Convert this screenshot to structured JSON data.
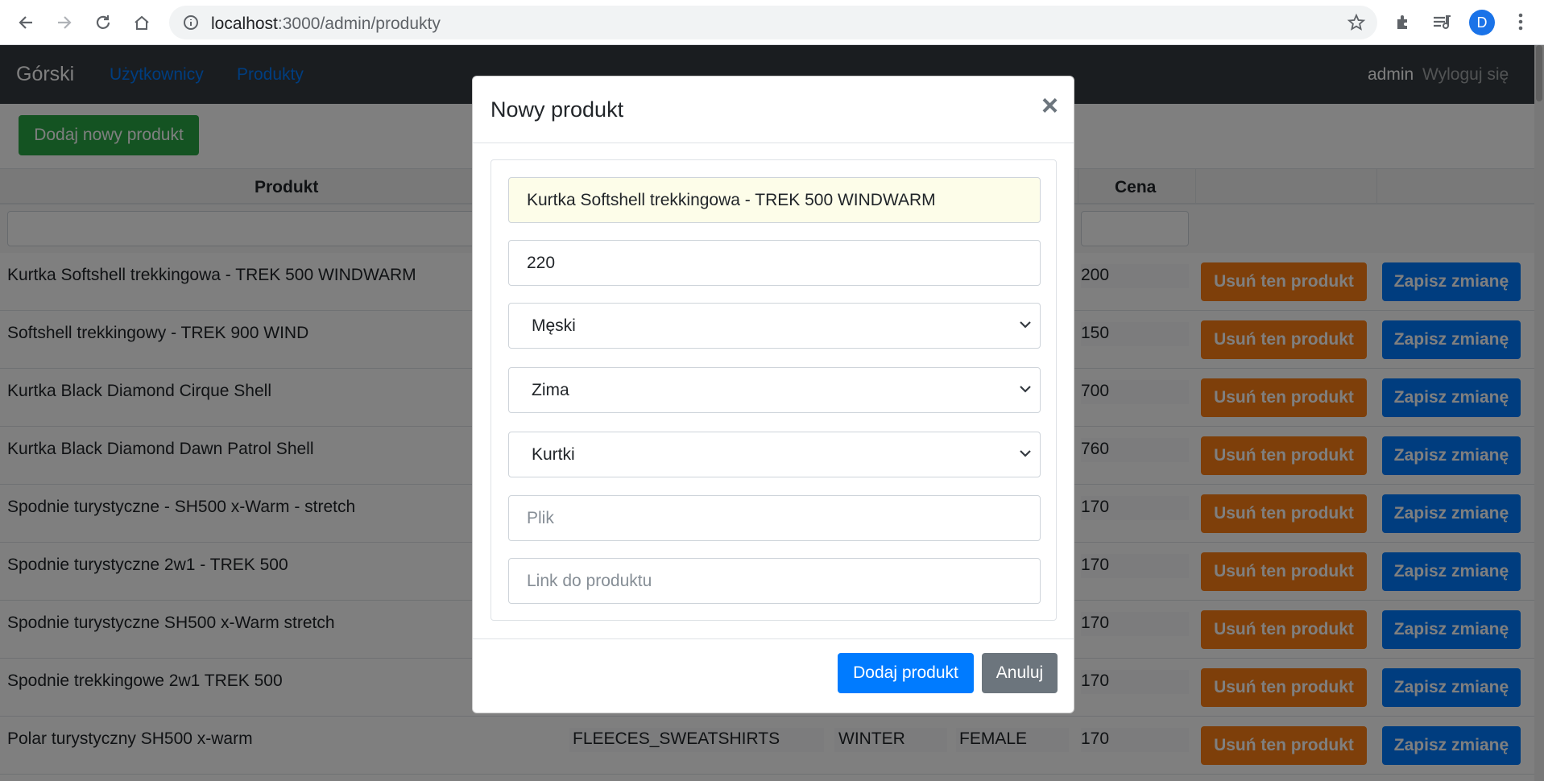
{
  "browser": {
    "url_host": "localhost",
    "url_path": ":3000/admin/produkty",
    "avatar_letter": "D"
  },
  "navbar": {
    "brand": "Górski",
    "links": [
      "Użytkownicy",
      "Produkty"
    ],
    "user": "admin",
    "logout": "Wyloguj się"
  },
  "page": {
    "add_button": "Dodaj nowy produkt"
  },
  "table": {
    "headers": {
      "product": "Produkt",
      "price": "Cena"
    },
    "rows": [
      {
        "name": "Kurtka Softshell trekkingowa - TREK 500 WINDWARM",
        "category": "",
        "season": "",
        "gender": "",
        "price": "200"
      },
      {
        "name": "Softshell trekkingowy - TREK 900 WIND",
        "category": "",
        "season": "",
        "gender": "",
        "price": "150"
      },
      {
        "name": "Kurtka Black Diamond Cirque Shell",
        "category": "",
        "season": "",
        "gender": "",
        "price": "700"
      },
      {
        "name": "Kurtka Black Diamond Dawn Patrol Shell",
        "category": "",
        "season": "",
        "gender": "",
        "price": "760"
      },
      {
        "name": "Spodnie turystyczne - SH500 x-Warm - stretch",
        "category": "",
        "season": "",
        "gender": "",
        "price": "170"
      },
      {
        "name": "Spodnie turystyczne 2w1 - TREK 500",
        "category": "",
        "season": "",
        "gender": "",
        "price": "170"
      },
      {
        "name": "Spodnie turystyczne SH500 x-Warm stretch",
        "category": "",
        "season": "",
        "gender": "",
        "price": "170"
      },
      {
        "name": "Spodnie trekkingowe 2w1 TREK 500",
        "category": "",
        "season": "",
        "gender": "",
        "price": "170"
      },
      {
        "name": "Polar turystyczny SH500 x-warm",
        "category": "FLEECES_SWEATSHIRTS",
        "season": "WINTER",
        "gender": "FEMALE",
        "price": "170"
      }
    ],
    "delete_label": "Usuń ten produkt",
    "save_label": "Zapisz zmianę"
  },
  "modal": {
    "title": "Nowy produkt",
    "close": "×",
    "fields": {
      "name": "Kurtka Softshell trekkingowa - TREK 500 WINDWARM",
      "price": "220",
      "gender": "Męski",
      "season": "Zima",
      "category": "Kurtki",
      "file_placeholder": "Plik",
      "link_placeholder": "Link do produktu"
    },
    "submit": "Dodaj produkt",
    "cancel": "Anuluj"
  }
}
